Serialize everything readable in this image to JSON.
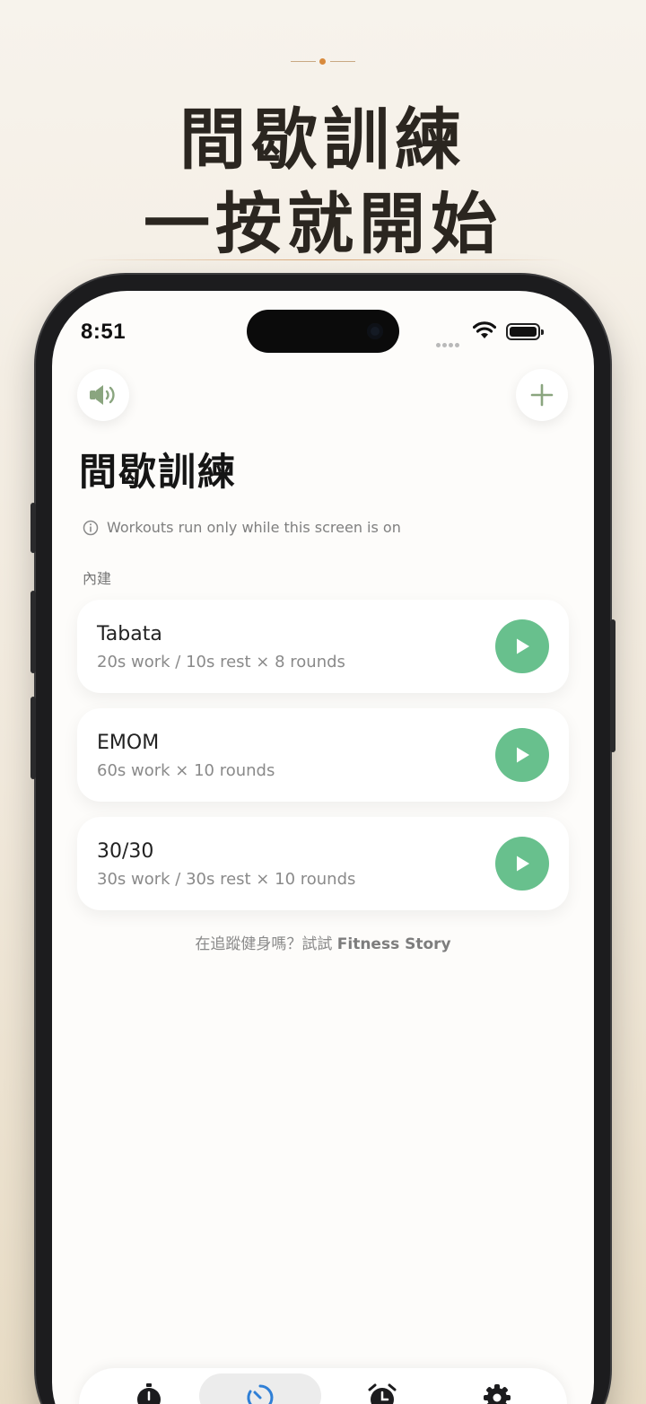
{
  "promo": {
    "headline_line1": "間歇訓練",
    "headline_line2": "一按就開始"
  },
  "status_bar": {
    "time": "8:51"
  },
  "header": {
    "title": "間歇訓練",
    "sound_icon": "speaker-icon",
    "add_icon": "plus-icon"
  },
  "notice": {
    "text": "Workouts run only while this screen is on"
  },
  "section": {
    "label": "內建"
  },
  "workouts": [
    {
      "name": "Tabata",
      "detail": "20s work / 10s rest × 8 rounds"
    },
    {
      "name": "EMOM",
      "detail": "60s work × 10 rounds"
    },
    {
      "name": "30/30",
      "detail": "30s work / 30s rest × 10 rounds"
    }
  ],
  "footer": {
    "prefix": "在追蹤健身嗎？試試 ",
    "brand": "Fitness Story"
  },
  "tabs": [
    {
      "icon": "stopwatch-icon",
      "active": false
    },
    {
      "icon": "timer-icon",
      "active": true
    },
    {
      "icon": "alarm-icon",
      "active": false
    },
    {
      "icon": "gear-icon",
      "active": false
    }
  ],
  "colors": {
    "accent_green": "#68c08d",
    "tab_active_blue": "#2f7fd6",
    "icon_sage": "#8aa57f"
  }
}
